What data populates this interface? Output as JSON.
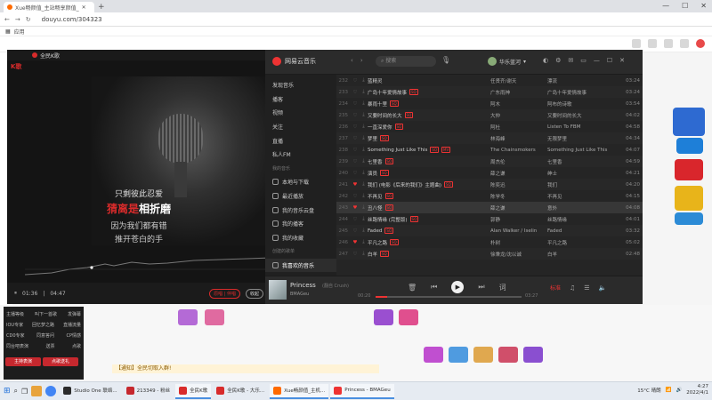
{
  "browser": {
    "tab_title": "Xue畅颜值_主站畅享颜值_",
    "new_tab_label": "+",
    "url": "douyu.com/304323",
    "bookmark": "应用",
    "window_controls": [
      "—",
      "☐",
      "✕"
    ]
  },
  "ktv": {
    "window_title": "全民K歌",
    "logo": "全民K歌",
    "lyrics": {
      "line1": "只剩彼此忍爱",
      "line2_sung": "猜离是",
      "line2_rest": "相折磨",
      "line3": "因为我们都有错",
      "line4": "推开苍白的手"
    },
    "time_current": "01:36",
    "time_total": "04:47",
    "btn_left": "原唱 | 伴唱",
    "btn_right": "收起"
  },
  "netease": {
    "app_name": "网易云音乐",
    "search_placeholder": "搜索",
    "user_name": "华乐蓝河",
    "sidebar": [
      {
        "label": "发现音乐",
        "type": "item"
      },
      {
        "label": "播客",
        "type": "item"
      },
      {
        "label": "视频",
        "type": "item"
      },
      {
        "label": "关注",
        "type": "item"
      },
      {
        "label": "直播",
        "type": "item"
      },
      {
        "label": "私人FM",
        "type": "item"
      },
      {
        "label": "我的音乐",
        "type": "sub"
      },
      {
        "label": "本地与下载",
        "type": "item"
      },
      {
        "label": "最近播放",
        "type": "item"
      },
      {
        "label": "我的音乐云盘",
        "type": "item"
      },
      {
        "label": "我的播客",
        "type": "item"
      },
      {
        "label": "我的收藏",
        "type": "item"
      },
      {
        "label": "创建的歌单",
        "type": "sub"
      },
      {
        "label": "我喜欢的音乐",
        "type": "item",
        "active": true
      }
    ],
    "songs": [
      {
        "no": "232",
        "liked": false,
        "title": "蓝精灵",
        "tags": [],
        "artist": "任贤齐/谢天",
        "album": "漂流",
        "duration": "03:24"
      },
      {
        "no": "233",
        "liked": false,
        "title": "广岛十年爱情故事",
        "tags": [
          "SQ"
        ],
        "artist": "广东雨神",
        "album": "广岛十年爱情故事",
        "duration": "03:24"
      },
      {
        "no": "234",
        "liked": false,
        "title": "暴雨十里",
        "tags": [
          "SQ"
        ],
        "artist": "阿木",
        "album": "阿布的诗歌",
        "duration": "03:54"
      },
      {
        "no": "235",
        "liked": false,
        "title": "又要时间的长大",
        "tags": [
          "SQ"
        ],
        "artist": "大仲",
        "album": "又要时间的长大",
        "duration": "04:02"
      },
      {
        "no": "236",
        "liked": false,
        "title": "一直深爱你",
        "tags": [
          "SQ"
        ],
        "artist": "阿杜",
        "album": "Listen To FBM",
        "duration": "04:58"
      },
      {
        "no": "237",
        "liked": false,
        "title": "梦里",
        "tags": [
          "SQ"
        ],
        "artist": "林海峰",
        "album": "无限梦里",
        "duration": "04:34"
      },
      {
        "no": "238",
        "liked": false,
        "title": "Something Just Like This",
        "tags": [
          "SQ",
          "MV"
        ],
        "artist": "The Chainsmokers",
        "album": "Something Just Like This",
        "duration": "04:07"
      },
      {
        "no": "239",
        "liked": false,
        "title": "七里香",
        "tags": [
          "SQ"
        ],
        "artist": "周杰伦",
        "album": "七里香",
        "duration": "04:59"
      },
      {
        "no": "240",
        "liked": false,
        "title": "演员",
        "tags": [
          "SQ"
        ],
        "artist": "薛之谦",
        "album": "绅士",
        "duration": "04:21"
      },
      {
        "no": "241",
        "liked": true,
        "title": "我们 (电影《后来的我们》主题曲)",
        "tags": [
          "SQ"
        ],
        "artist": "陈奕迅",
        "album": "我们",
        "duration": "04:20"
      },
      {
        "no": "242",
        "liked": false,
        "title": "不再见",
        "tags": [
          "SQ"
        ],
        "artist": "陈学冬",
        "album": "不再见",
        "duration": "04:15"
      },
      {
        "no": "243",
        "liked": true,
        "title": "丑八怪",
        "tags": [
          "SQ"
        ],
        "artist": "薛之谦",
        "album": "意外",
        "duration": "04:08"
      },
      {
        "no": "244",
        "liked": false,
        "title": "丝路情缘 (完整版)",
        "tags": [
          "SQ"
        ],
        "artist": "郭静",
        "album": "丝路情缘",
        "duration": "04:01"
      },
      {
        "no": "245",
        "liked": false,
        "title": "Faded",
        "tags": [
          "SQ"
        ],
        "artist": "Alan Walker / Iselin",
        "album": "Faded",
        "duration": "03:32"
      },
      {
        "no": "246",
        "liked": true,
        "title": "平凡之路",
        "tags": [
          "SQ"
        ],
        "artist": "朴树",
        "album": "平凡之路",
        "duration": "05:02"
      },
      {
        "no": "247",
        "liked": false,
        "title": "白羊",
        "tags": [
          "SQ"
        ],
        "artist": "徐秉龙/沈以诚",
        "album": "白羊",
        "duration": "02:48"
      }
    ],
    "player": {
      "title": "Princess",
      "subtitle": "(翻自 Crush)",
      "artist": "BMAGeu",
      "time_current": "00:20",
      "time_total": "03:27",
      "progress": 0.08,
      "quality": "标准",
      "play_icon": "▶",
      "prev_icon": "⏮",
      "next_icon": "⏭",
      "mode_icon": "⇄",
      "lyric_icon": "词"
    }
  },
  "douyu": {
    "chat_notice": "【通知】全民切取入群!",
    "left_panel": [
      [
        "主播等级",
        "叫下一首歌",
        "发弹幕"
      ],
      [
        "IOU专家",
        "回忆梦之路",
        "直播流量"
      ],
      [
        "CD0专家",
        "同意答问",
        "CP情感"
      ],
      [
        "同台吧表演",
        "送票",
        "点歌"
      ]
    ],
    "gift_btn1": "主持表演",
    "gift_btn2": "点歌送礼"
  },
  "taskbar": {
    "apps": [
      {
        "label": "Studio One 联络...",
        "color": "#2b2b2b",
        "active": false
      },
      {
        "label": "213349 - 粉丝",
        "color": "#c6282e",
        "active": false
      },
      {
        "label": "全民K歌",
        "color": "#d82b2b",
        "active": true
      },
      {
        "label": "全民K歌 - 大乐...",
        "color": "#d82b2b",
        "active": false
      },
      {
        "label": "Xue畅颜值_主机...",
        "color": "#ff6a00",
        "active": true
      },
      {
        "label": "Princess - BMAGeu",
        "color": "#e33",
        "active": true
      }
    ],
    "weather": "15°C 晴朗",
    "time": "4:27",
    "date": "2022/4/1"
  }
}
